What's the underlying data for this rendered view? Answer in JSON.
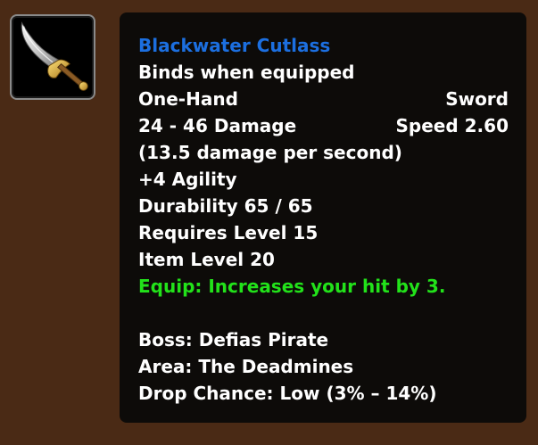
{
  "item": {
    "name": "Blackwater Cutlass",
    "binding": "Binds when equipped",
    "slot": "One-Hand",
    "type": "Sword",
    "damage": "24 - 46 Damage",
    "speed": "Speed 2.60",
    "dps": "(13.5 damage per second)",
    "stat": "+4 Agility",
    "durability": "Durability 65 / 65",
    "required_level": "Requires Level 15",
    "item_level": "Item Level 20",
    "equip_effect": "Equip: Increases your hit by 3."
  },
  "source": {
    "boss": "Boss: Defias Pirate",
    "area": "Area: The Deadmines",
    "drop_chance": "Drop Chance: Low (3% – 14%)"
  },
  "icon": "cutlass-sword-icon",
  "colors": {
    "item_name": "#1c6fe0",
    "equip_effect": "#22e21a",
    "text": "#ffffff",
    "tooltip_bg": "#0d0b09",
    "page_bg": "#4a2a15"
  }
}
